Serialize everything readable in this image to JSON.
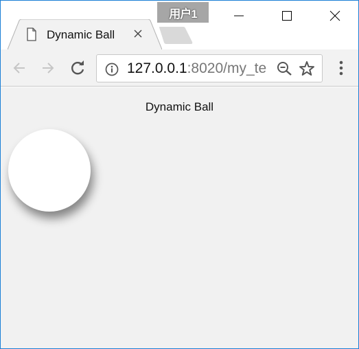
{
  "window": {
    "profile_name": "用户1",
    "controls": {
      "minimize": "minimize",
      "maximize": "maximize",
      "close": "close"
    }
  },
  "tabs": [
    {
      "title": "Dynamic Ball",
      "icon": "document-icon",
      "active": true
    }
  ],
  "toolbar": {
    "url_host": "127.0.0.1",
    "url_rest": ":8020/my_te",
    "icons": [
      "back-arrow-icon",
      "forward-arrow-icon",
      "reload-icon",
      "info-icon",
      "zoom-out-icon",
      "star-icon",
      "menu-dots-icon"
    ]
  },
  "page": {
    "heading": "Dynamic Ball",
    "ball_color": "#ffffff",
    "background_color": "#f1f1f1"
  },
  "colors": {
    "window_border": "#1a7fd6",
    "profile_badge": "#a6a6a6"
  }
}
